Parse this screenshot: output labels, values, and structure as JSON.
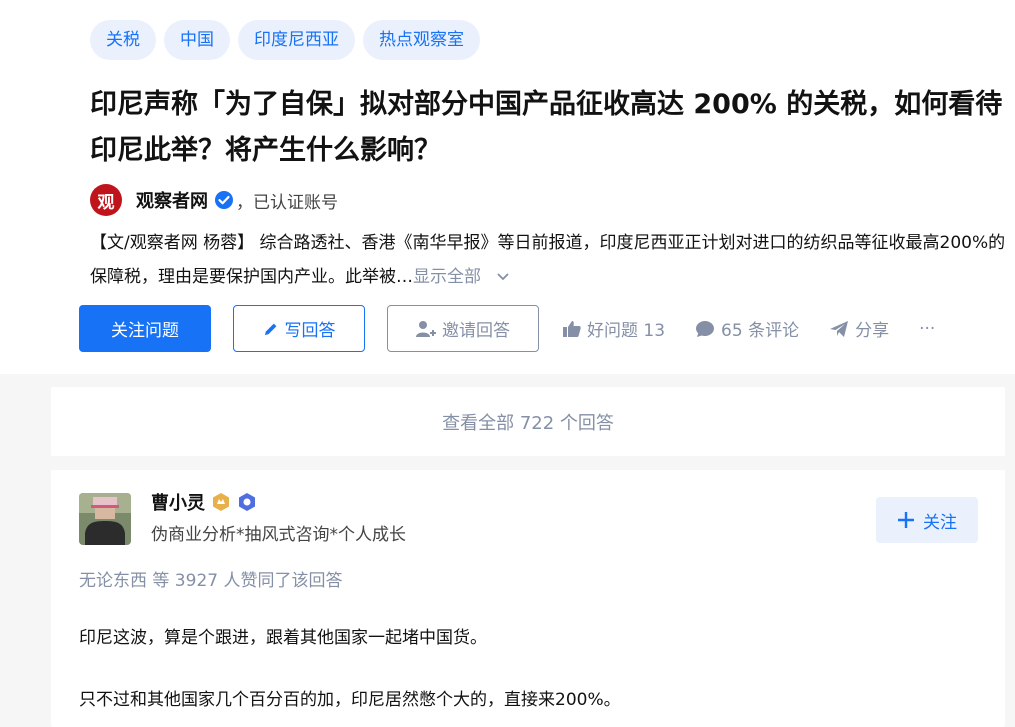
{
  "tags": [
    "关税",
    "中国",
    "印度尼西亚",
    "热点观察室"
  ],
  "question": {
    "title": "印尼声称「为了自保」拟对部分中国产品征收高达 200% 的关税，如何看待印尼此举？将产生什么影响？",
    "author_logo_text": "观",
    "author_name": "观察者网",
    "author_suffix": "，已认证账号",
    "excerpt": "【文/观察者网 杨蓉】 综合路透社、香港《南华早报》等日前报道，印度尼西亚正计划对进口的纺织品等征收最高200%的保障税，理由是要保护国内产业。此举被…",
    "show_all": "显示全部"
  },
  "actions": {
    "follow_question": "关注问题",
    "write_answer": "写回答",
    "invite_answer": "邀请回答",
    "good_question": "好问题 13",
    "comments": "65 条评论",
    "share": "分享",
    "more": "···"
  },
  "view_all_answers": "查看全部 722 个回答",
  "answer": {
    "author_name": "曹小灵",
    "author_bio": "伪商业分析*抽风式咨询*个人成长",
    "follow_label": "关注",
    "voters_text": "无论东西 等 3927 人赞同了该回答",
    "paragraphs": [
      "印尼这波，算是个跟进，跟着其他国家一起堵中国货。",
      "只不过和其他国家几个百分百的加，印尼居然憋个大的，直接来200%。"
    ]
  },
  "colors": {
    "accent": "#1772f6",
    "muted": "#8590a6",
    "tag_bg": "#eaf1fd"
  }
}
